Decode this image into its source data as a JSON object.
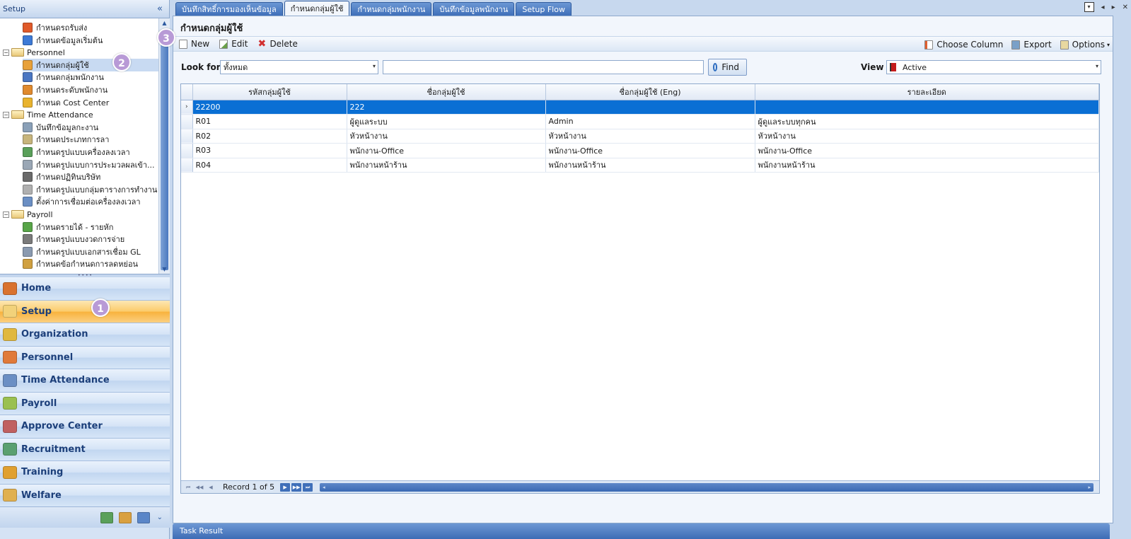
{
  "left_panel": {
    "title": "Setup",
    "collapse": "«",
    "tree": [
      {
        "label": "กำหนดรถรับส่ง",
        "level": 2,
        "color": "#e05a2a"
      },
      {
        "label": "กำหนดข้อมูลเริ่มต้น",
        "level": 2,
        "color": "#3d7ad6"
      },
      {
        "label": "Personnel",
        "level": 1,
        "group": true
      },
      {
        "label": "กำหนดกลุ่มผู้ใช้",
        "level": 2,
        "color": "#e8a13a",
        "selected": true
      },
      {
        "label": "กำหนดกลุ่มพนักงาน",
        "level": 2,
        "color": "#4a76c2"
      },
      {
        "label": "กำหนดระดับพนักงาน",
        "level": 2,
        "color": "#e08a2e"
      },
      {
        "label": "กำหนด Cost Center",
        "level": 2,
        "color": "#e9b32e"
      },
      {
        "label": "Time Attendance",
        "level": 1,
        "group": true
      },
      {
        "label": "บันทึกข้อมูลกะงาน",
        "level": 2,
        "color": "#8aa0b8"
      },
      {
        "label": "กำหนดประเภทการลา",
        "level": 2,
        "color": "#c7b57c"
      },
      {
        "label": "กำหนดรูปแบบเครื่องลงเวลา",
        "level": 2,
        "color": "#5aa05a"
      },
      {
        "label": "กำหนดรูปแบบการประมวลผลเข้า...",
        "level": 2,
        "color": "#9aa7b5"
      },
      {
        "label": "กำหนดปฏิทินบริษัท",
        "level": 2,
        "color": "#6a6a6a"
      },
      {
        "label": "กำหนดรูปแบบกลุ่มตารางการทำงาน",
        "level": 2,
        "color": "#b0b0b0"
      },
      {
        "label": "ตั้งค่าการเชื่อมต่อเครื่องลงเวลา",
        "level": 2,
        "color": "#6b8fc4"
      },
      {
        "label": "Payroll",
        "level": 1,
        "group": true
      },
      {
        "label": "กำหนดรายได้ - รายหัก",
        "level": 2,
        "color": "#58a548"
      },
      {
        "label": "กำหนดรูปแบบงวดการจ่าย",
        "level": 2,
        "color": "#7a7a7a"
      },
      {
        "label": "กำหนดรูปแบบเอกสารเชื่อม GL",
        "level": 2,
        "color": "#8a9ab0"
      },
      {
        "label": "กำหนดข้อกำหนดการลดหย่อน",
        "level": 2,
        "color": "#d0a040"
      }
    ],
    "nav": [
      {
        "label": "Home",
        "icon": "home-icon",
        "color": "#d9722e"
      },
      {
        "label": "Setup",
        "icon": "setup-icon",
        "color": "#f2d27a",
        "active": true
      },
      {
        "label": "Organization",
        "icon": "organization-icon",
        "color": "#e0b840"
      },
      {
        "label": "Personnel",
        "icon": "personnel-icon",
        "color": "#e07a3a"
      },
      {
        "label": "Time Attendance",
        "icon": "clock-icon",
        "color": "#6b8fc4"
      },
      {
        "label": "Payroll",
        "icon": "payroll-icon",
        "color": "#9ac050"
      },
      {
        "label": "Approve Center",
        "icon": "approve-icon",
        "color": "#c06060"
      },
      {
        "label": "Recruitment",
        "icon": "recruitment-icon",
        "color": "#5aa070"
      },
      {
        "label": "Training",
        "icon": "training-icon",
        "color": "#e0a030"
      },
      {
        "label": "Welfare",
        "icon": "welfare-icon",
        "color": "#e0b050"
      }
    ],
    "bottom_chevron": "⌄"
  },
  "badges": {
    "b1": "1",
    "b2": "2",
    "b3": "3"
  },
  "tabs": [
    {
      "label": "บันทึกสิทธิ์การมองเห็นข้อมูล"
    },
    {
      "label": "กำหนดกลุ่มผู้ใช้",
      "active": true
    },
    {
      "label": "กำหนดกลุ่มพนักงาน"
    },
    {
      "label": "บันทึกข้อมูลพนักงาน"
    },
    {
      "label": "Setup Flow"
    }
  ],
  "tab_controls": {
    "dropdown": "▾",
    "prev": "◂",
    "next": "▸",
    "close": "✕"
  },
  "page_title": "กำหนดกลุ่มผู้ใช้",
  "toolbar": {
    "new": "New",
    "edit": "Edit",
    "delete": "Delete",
    "choose_column": "Choose Column",
    "export": "Export",
    "options": "Options",
    "options_caret": "▾"
  },
  "search": {
    "look_for_label": "Look for",
    "look_for_value": "ทั้งหมด",
    "search_text": "",
    "find_label": "Find",
    "view_label": "View",
    "view_value": "Active",
    "dropdown": "▾"
  },
  "grid": {
    "columns": [
      "รหัสกลุ่มผู้ใช้",
      "ชื่อกลุ่มผู้ใช้",
      "ชื่อกลุ่มผู้ใช้ (Eng)",
      "รายละเอียด"
    ],
    "rows": [
      {
        "indicator": "›",
        "cells": [
          "22200",
          "222",
          "",
          ""
        ],
        "selected": true
      },
      {
        "indicator": "",
        "cells": [
          "R01",
          "ผู้ดูแลระบบ",
          "Admin",
          "ผู้ดูแลระบบทุกคน"
        ]
      },
      {
        "indicator": "",
        "cells": [
          "R02",
          "หัวหน้างาน",
          "หัวหน้างาน",
          "หัวหน้างาน"
        ]
      },
      {
        "indicator": "",
        "cells": [
          "R03",
          "พนักงาน-Office",
          "พนักงาน-Office",
          "พนักงาน-Office"
        ]
      },
      {
        "indicator": "",
        "cells": [
          "R04",
          "พนักงานหน้าร้าน",
          "พนักงานหน้าร้าน",
          "พนักงานหน้าร้าน"
        ]
      }
    ],
    "pager": {
      "first": "⏮",
      "prev_page": "◀◀",
      "prev": "◀",
      "record_text": "Record 1 of 5",
      "next": "▶",
      "next_page": "▶▶",
      "last": "⏭",
      "scroll_left": "◂",
      "scroll_right": "▸"
    }
  },
  "task_result": "Task Result"
}
